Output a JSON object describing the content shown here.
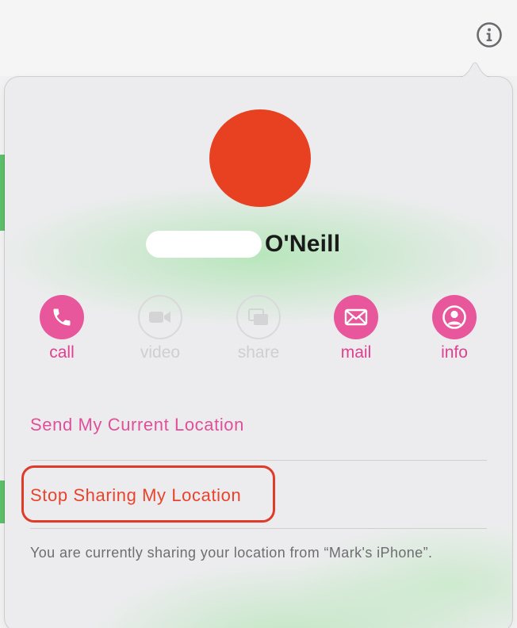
{
  "contact": {
    "name_visible": "O'Neill",
    "avatar_color": "#e84122"
  },
  "actions": [
    {
      "label": "call",
      "icon": "phone-icon",
      "enabled": true
    },
    {
      "label": "video",
      "icon": "video-camera-icon",
      "enabled": false
    },
    {
      "label": "share",
      "icon": "share-screen-icon",
      "enabled": false
    },
    {
      "label": "mail",
      "icon": "envelope-icon",
      "enabled": true
    },
    {
      "label": "info",
      "icon": "person-icon",
      "enabled": true
    }
  ],
  "location": {
    "send_label": "Send My Current Location",
    "stop_label": "Stop Sharing My Location",
    "note": "You are currently sharing your location from “Mark's iPhone”."
  },
  "colors": {
    "accent": "#e0408f",
    "stop": "#e8432d",
    "highlight_border": "#e03a28"
  }
}
